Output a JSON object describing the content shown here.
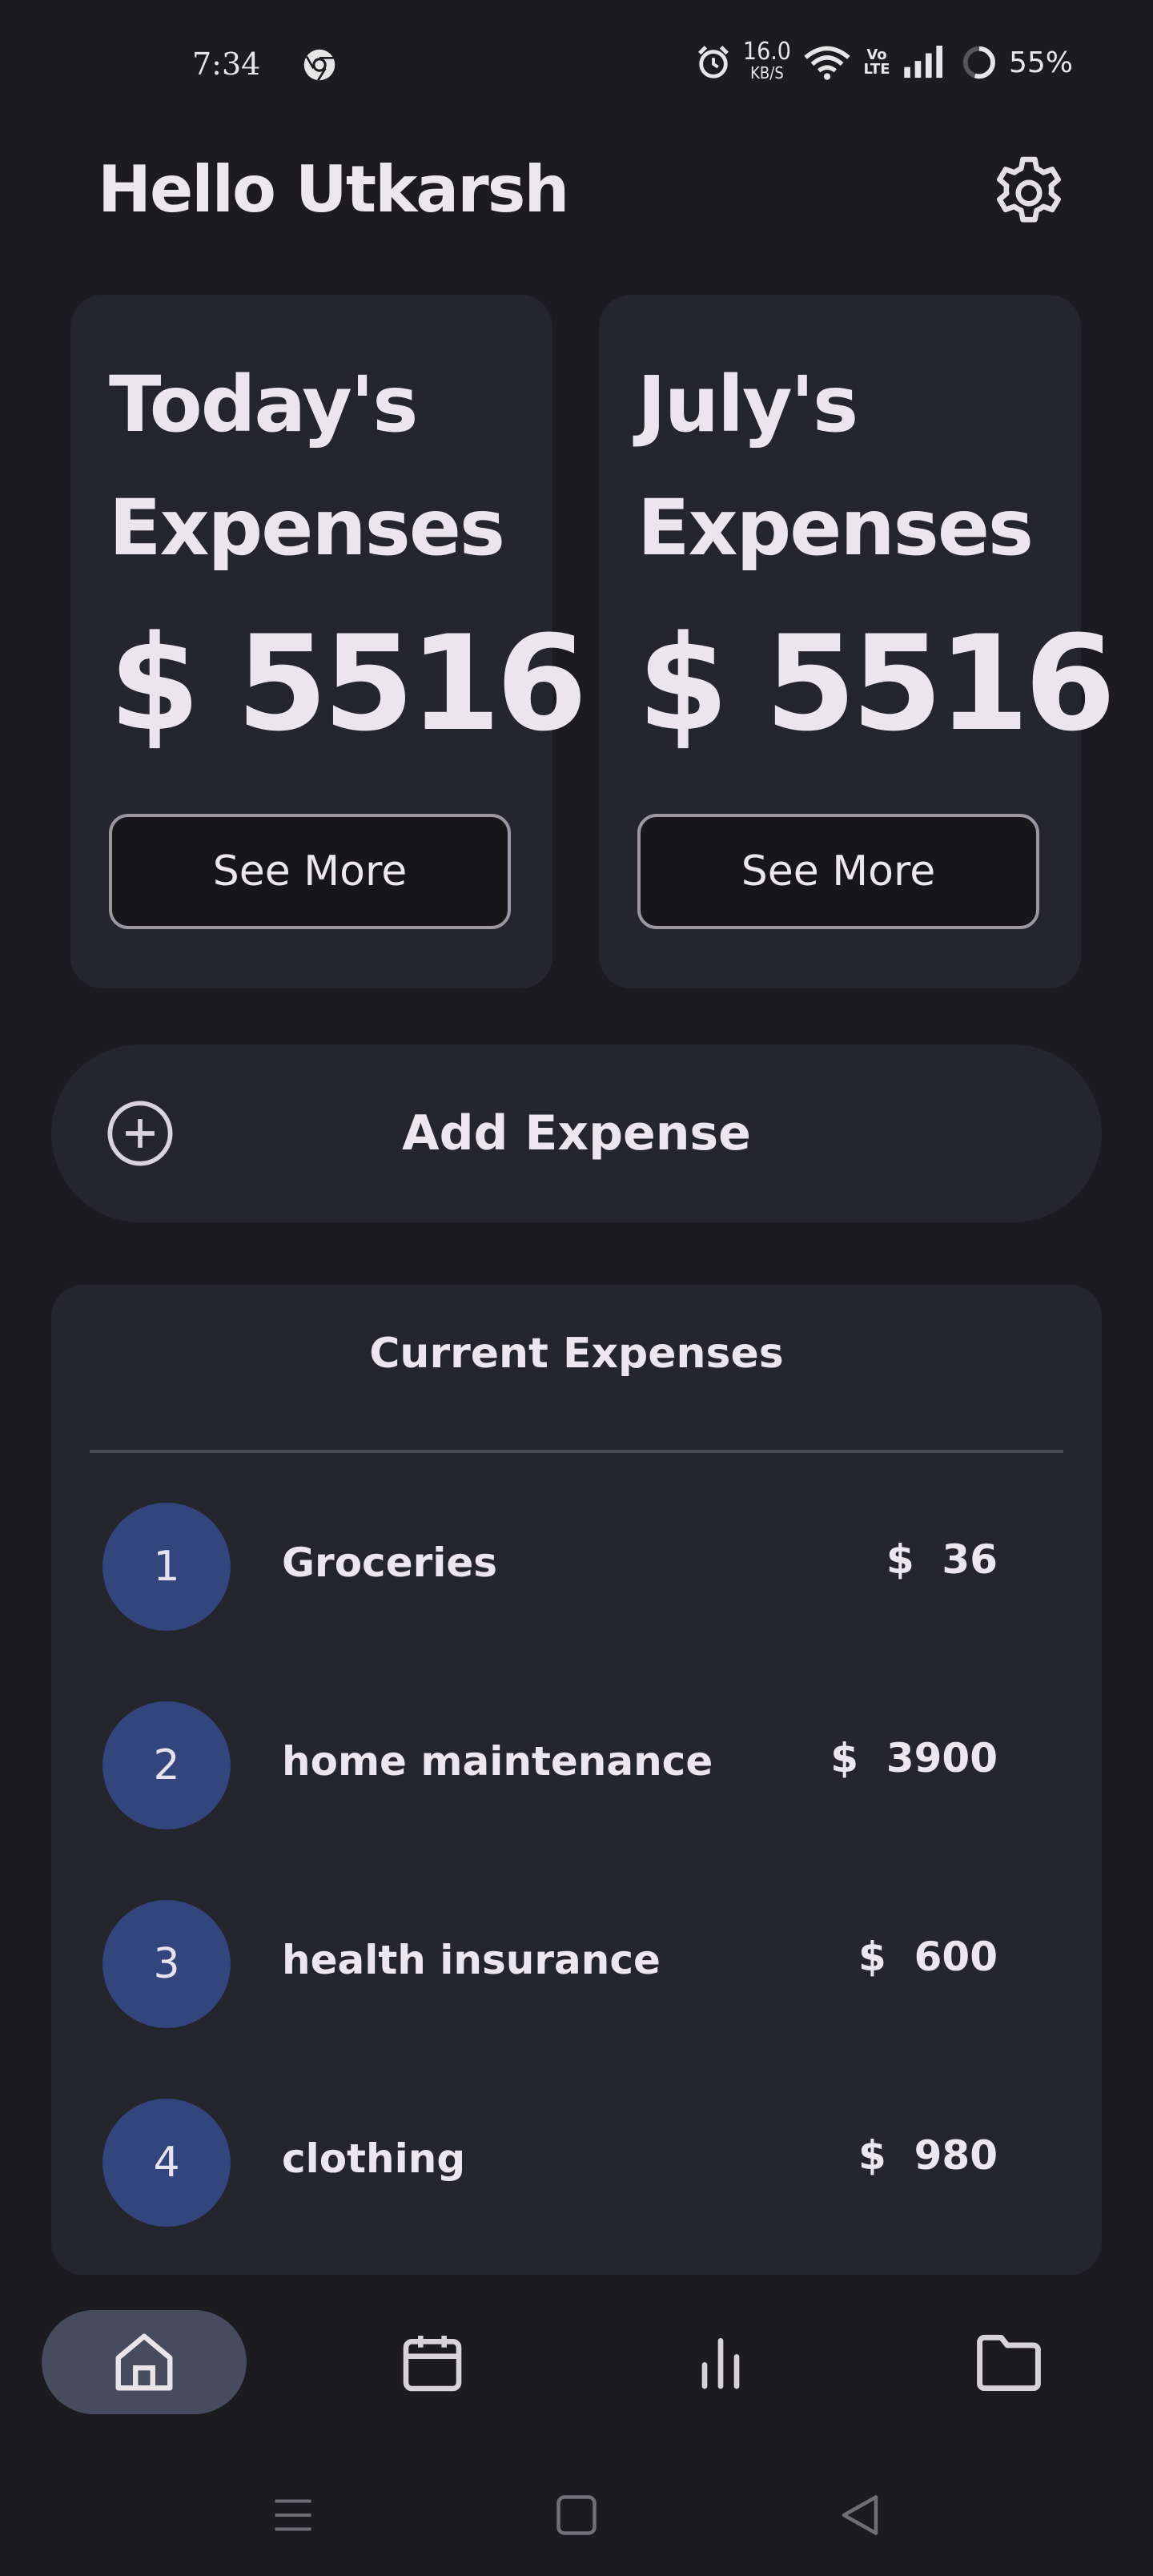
{
  "status_bar": {
    "time": "7:34",
    "speed_value": "16.0",
    "speed_unit": "KB/S",
    "volte": "Vo LTE",
    "battery": "55%"
  },
  "header": {
    "greeting": "Hello Utkarsh"
  },
  "cards": [
    {
      "title": "Today's Expenses",
      "amount": "$ 5516",
      "button": "See More"
    },
    {
      "title": "July's Expenses",
      "amount": "$ 5516",
      "button": "See More"
    }
  ],
  "add_expense": {
    "label": "Add Expense"
  },
  "current_expenses": {
    "title": "Current Expenses",
    "items": [
      {
        "index": "1",
        "name": "Groceries",
        "amount": "$  36"
      },
      {
        "index": "2",
        "name": "home maintenance",
        "amount": "$  3900"
      },
      {
        "index": "3",
        "name": "health insurance",
        "amount": "$  600"
      },
      {
        "index": "4",
        "name": "clothing",
        "amount": "$  980"
      }
    ]
  },
  "bottom_nav": {
    "items": [
      {
        "icon": "home-icon",
        "active": true
      },
      {
        "icon": "calendar-icon",
        "active": false
      },
      {
        "icon": "bar-chart-icon",
        "active": false
      },
      {
        "icon": "folder-icon",
        "active": false
      }
    ]
  },
  "colors": {
    "background": "#1b1b20",
    "card": "#25252e",
    "badge": "#33457d",
    "nav_active": "#464b5d",
    "text": "#ece7ec"
  }
}
